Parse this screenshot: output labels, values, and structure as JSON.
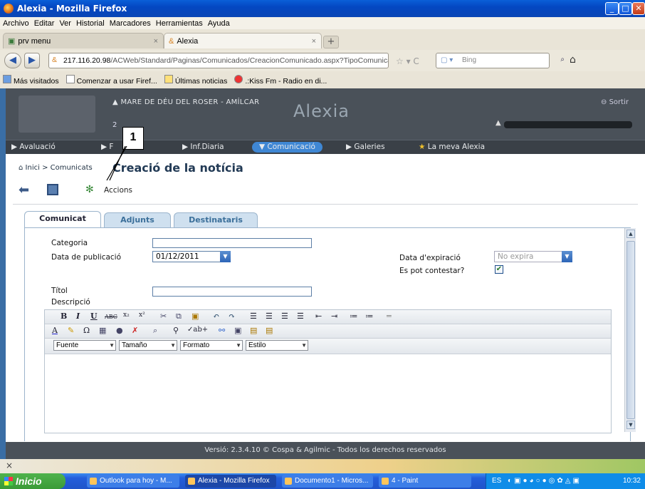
{
  "window": {
    "title": "Alexia - Mozilla Firefox"
  },
  "menubar": [
    "Archivo",
    "Editar",
    "Ver",
    "Historial",
    "Marcadores",
    "Herramientas",
    "Ayuda"
  ],
  "browser_tabs": [
    {
      "label": "prv menu",
      "active": false
    },
    {
      "label": "Alexia",
      "active": true
    }
  ],
  "nav": {
    "url_host": "217.116.20.98",
    "url_path": "/ACWeb/Standard/Paginas/Comunicados/CreacionComunicado.aspx?TipoComunicado=N#",
    "search_placeholder": "Bing"
  },
  "bookmarks": [
    "Más visitados",
    "Comenzar a usar Firef...",
    "Últimas noticias",
    ".:Kiss Fm - Radio en di..."
  ],
  "app": {
    "school": "MARE DE DÉU DEL ROSER - AMÍLCAR",
    "brand": "Alexia",
    "sortir": "Sortir",
    "year_fragment": "2"
  },
  "mainnav": [
    "Avaluació",
    "Inf.Diaria",
    "Comunicació",
    "Galeries",
    "La meva Alexia"
  ],
  "breadcrumb": {
    "home": "Inici",
    "sep": ">",
    "item": "Comunicats"
  },
  "page_title": "Creació de la notícia",
  "toolbar": {
    "actions": "Accions"
  },
  "annotation": {
    "number": "1"
  },
  "form_tabs": [
    "Comunicat",
    "Adjunts",
    "Destinataris"
  ],
  "form": {
    "category_label": "Categoria",
    "pubdate_label": "Data de publicació",
    "pubdate_value": "01/12/2011",
    "expdate_label": "Data d'expiració",
    "expdate_value": "No expira",
    "reply_label": "Es pot contestar?",
    "reply_checked": true,
    "title_label": "Títol",
    "desc_label": "Descripció"
  },
  "editor": {
    "font": "Fuente",
    "size": "Tamaño",
    "format": "Formato",
    "style": "Estilo"
  },
  "footer": "Versió: 2.3.4.10 © Cospa & Agilmic - Todos los derechos reservados",
  "taskbar": {
    "start": "Inicio",
    "tasks": [
      "Outlook para hoy - M...",
      "Alexia - Mozilla Firefox",
      "Documento1 - Micros...",
      "4 - Paint"
    ],
    "lang": "ES",
    "time": "10:32"
  }
}
